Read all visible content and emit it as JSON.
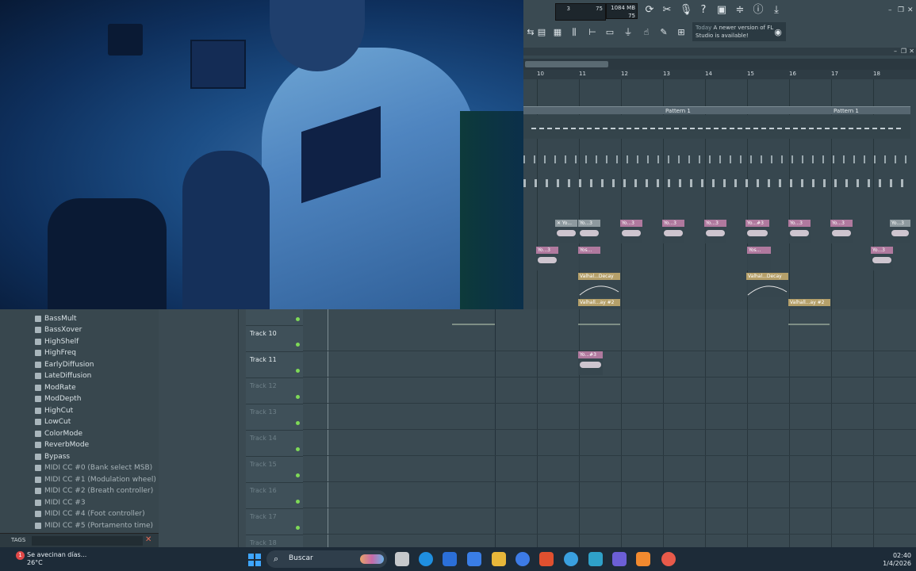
{
  "toolbar": {
    "tempo_a": "3",
    "tempo_b": "75",
    "memory_top": "1084 MB",
    "memory_bottom": "75",
    "news_today": "Today",
    "news_text": "A newer version of FL Studio is available!"
  },
  "timeline": {
    "bars": [
      "10",
      "11",
      "12",
      "13",
      "14",
      "15",
      "16",
      "17",
      "18"
    ]
  },
  "patterns": [
    {
      "label": "Pattern 1"
    },
    {
      "label": "Pattern 1"
    }
  ],
  "clips": {
    "row1": [
      "Yo...3",
      "Yo...3",
      "Yo...3",
      "Yo...3",
      "Yo...3",
      "Yo...#3",
      "Yo...3",
      "Yo...3",
      "Yo...3"
    ],
    "row2": [
      "Yo...3",
      "Yos...",
      "Yos...",
      "Yo...3"
    ],
    "auto1": [
      "Valhal...Decay",
      "Valhal...Decay"
    ],
    "auto2": [
      "Valhall...ay #2",
      "Valhall...ay #2"
    ],
    "row_track11": "Yo...#3"
  },
  "browser": {
    "items": [
      "BassMult",
      "BassXover",
      "HighShelf",
      "HighFreq",
      "EarlyDiffusion",
      "LateDiffusion",
      "ModRate",
      "ModDepth",
      "HighCut",
      "LowCut",
      "ColorMode",
      "ReverbMode",
      "Bypass",
      "MIDI CC #0 (Bank select MSB)",
      "MIDI CC #1 (Modulation wheel)",
      "MIDI CC #2 (Breath controller)",
      "MIDI CC #3",
      "MIDI CC #4 (Foot controller)",
      "MIDI CC #5 (Portamento time)"
    ],
    "tags_label": "TAGS"
  },
  "tracks": [
    {
      "name": "Track 10",
      "dim": false
    },
    {
      "name": "Track 11",
      "dim": false
    },
    {
      "name": "Track 12",
      "dim": true
    },
    {
      "name": "Track 13",
      "dim": true
    },
    {
      "name": "Track 14",
      "dim": true
    },
    {
      "name": "Track 15",
      "dim": true
    },
    {
      "name": "Track 16",
      "dim": true
    },
    {
      "name": "Track 17",
      "dim": true
    },
    {
      "name": "Track 18",
      "dim": true
    }
  ],
  "taskbar": {
    "weather_title": "Se avecinan días...",
    "weather_temp": "26°C",
    "notification_count": "1",
    "search_label": "Buscar",
    "time": "02:40",
    "date": "1/4/2026",
    "app_colors": [
      "#c6c9cc",
      "#1f8fe0",
      "#2b6fd8",
      "#3a7ee6",
      "#e8b73a",
      "#3d7be6",
      "#e0502f",
      "#3aa0e0",
      "#2fa1c9",
      "#6c5fd6",
      "#f28a2f",
      "#e85a4a"
    ]
  },
  "colors": {
    "clip_header": "#b0799e",
    "auto_header": "#b5a06a",
    "led": "#7ed957"
  }
}
